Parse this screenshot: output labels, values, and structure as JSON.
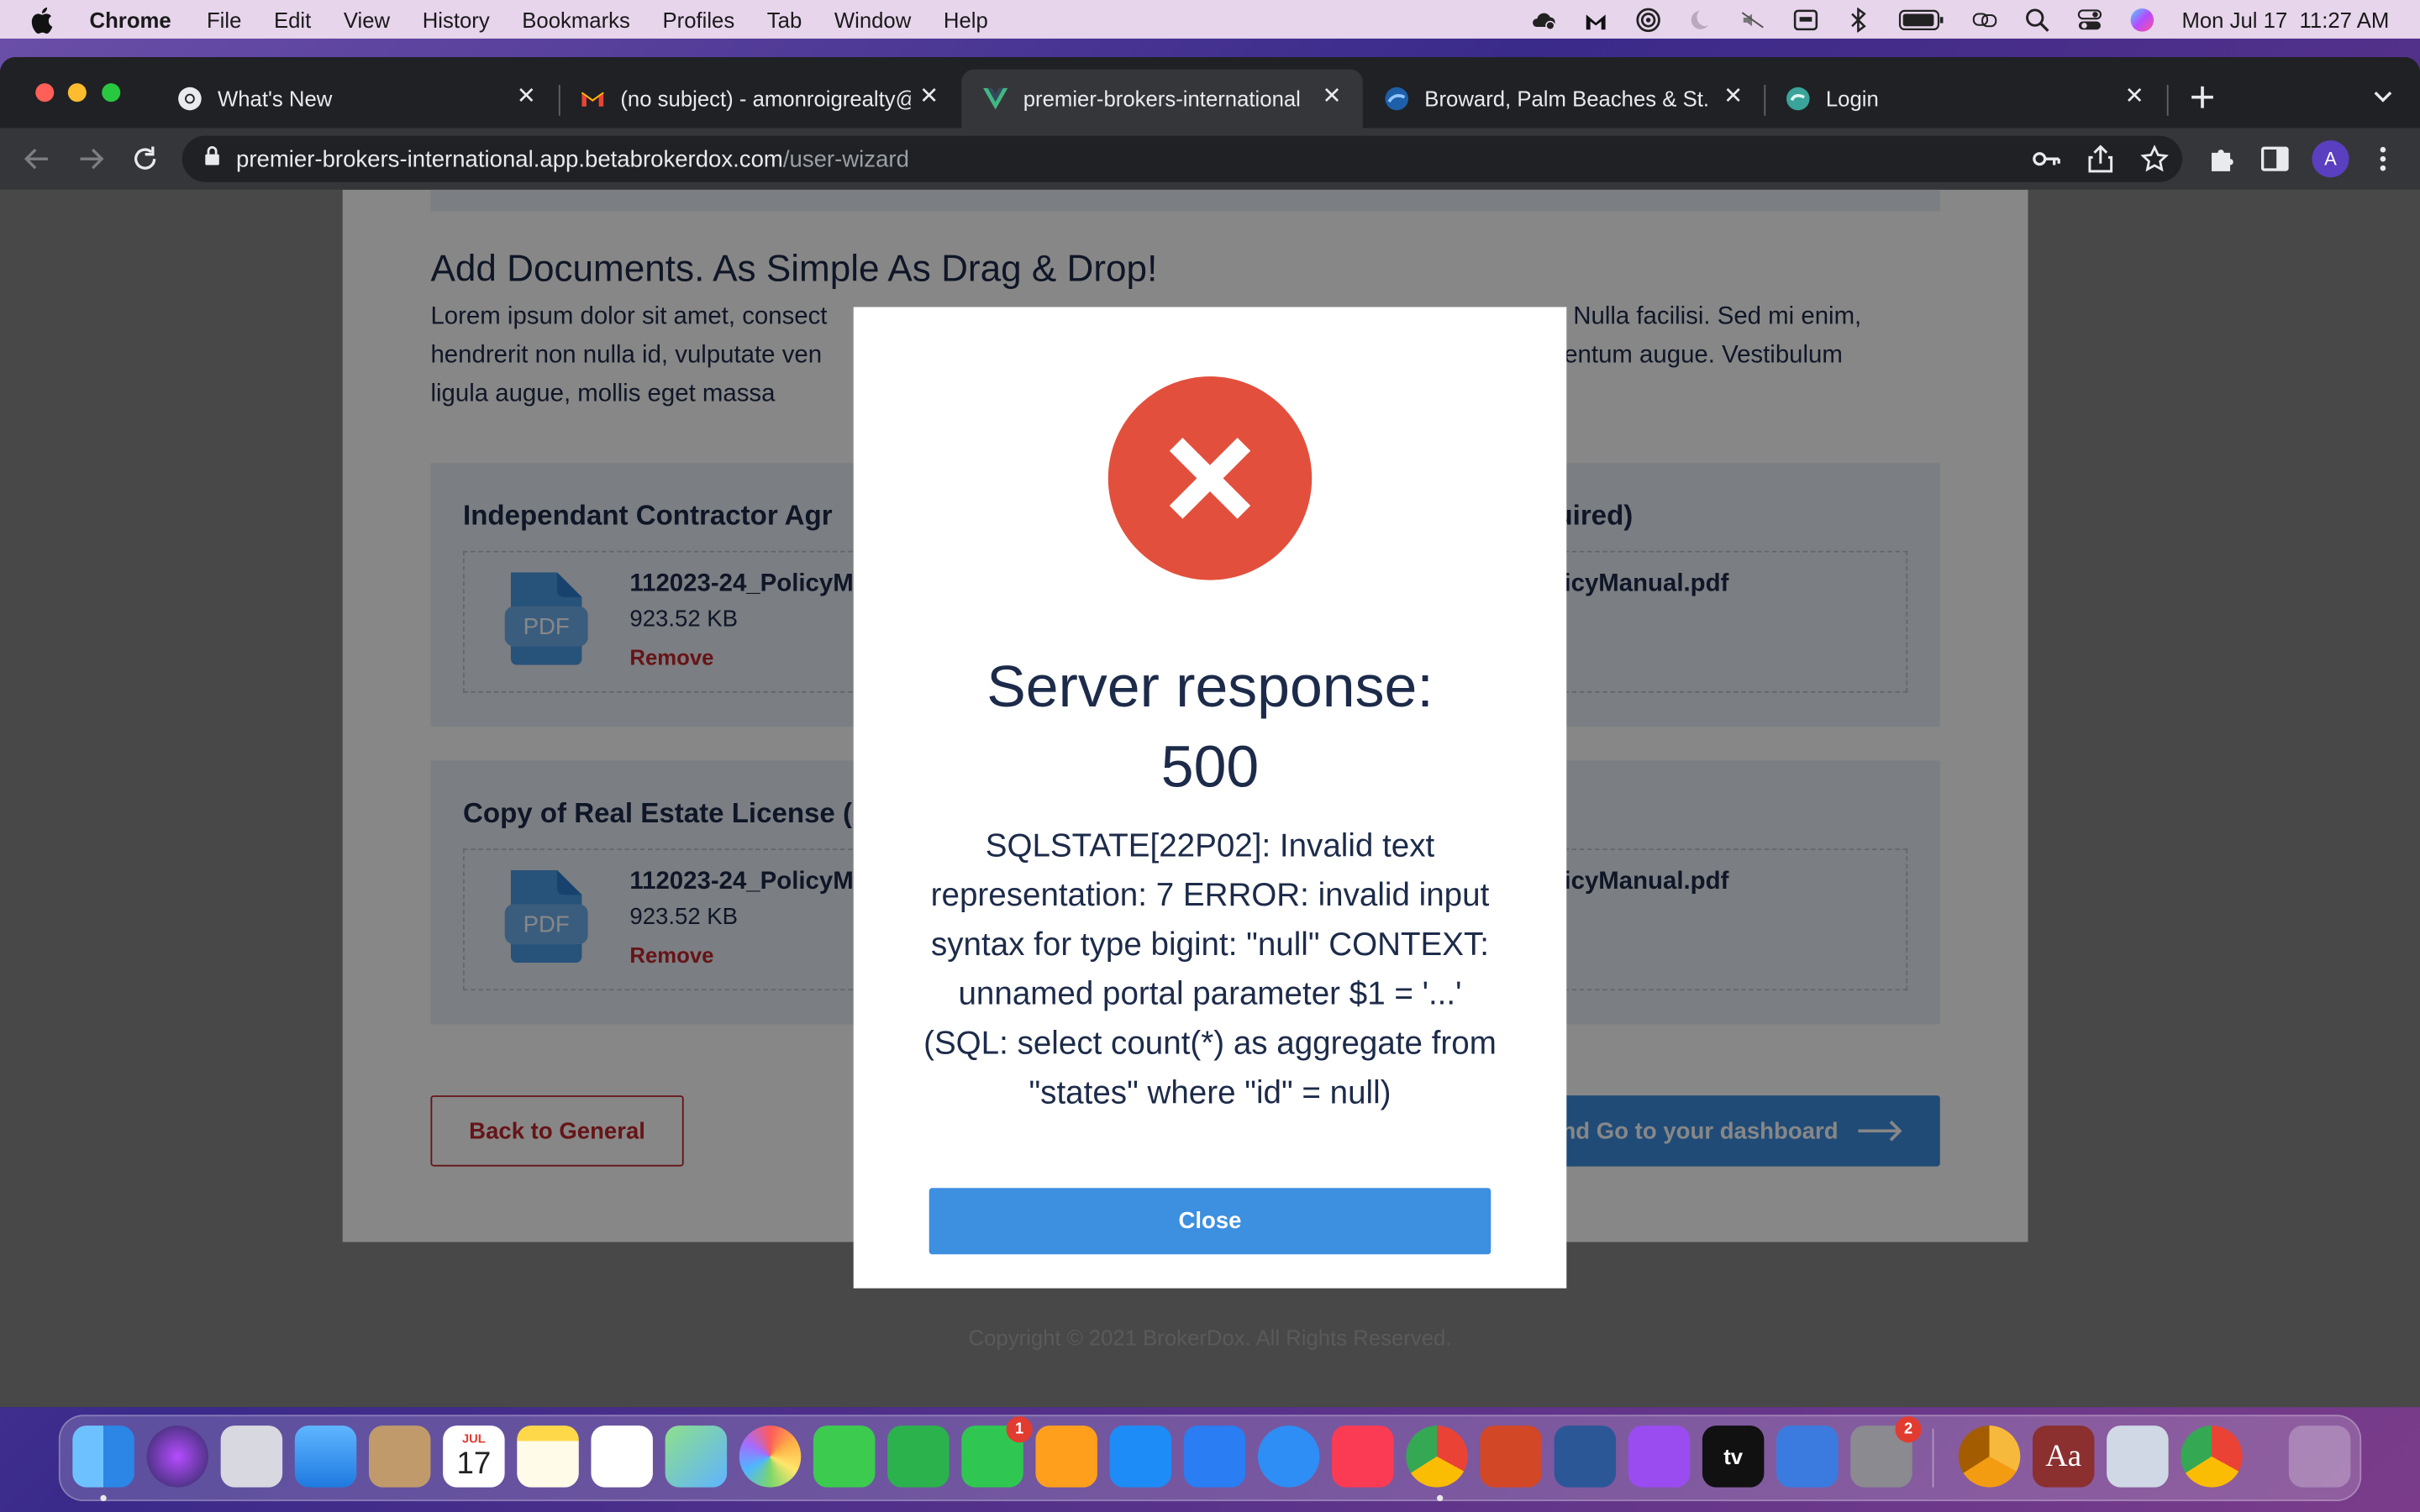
{
  "menubar": {
    "app": "Chrome",
    "items": [
      "File",
      "Edit",
      "View",
      "History",
      "Bookmarks",
      "Profiles",
      "Tab",
      "Window",
      "Help"
    ],
    "clock": "Mon Jul 17  11:27 AM"
  },
  "browser": {
    "tabs": [
      {
        "title": "What's New",
        "icon": "chrome-icon"
      },
      {
        "title": "(no subject) - amonroigrealty@",
        "icon": "gmail-icon"
      },
      {
        "title": "premier-brokers-international",
        "icon": "vue-icon"
      },
      {
        "title": "Broward, Palm Beaches & St. L",
        "icon": "realtor-icon"
      },
      {
        "title": "Login",
        "icon": "login-site-icon"
      }
    ],
    "url_host": "premier-brokers-international.app.betabrokerdox.com",
    "url_path": "/user-wizard",
    "profile_initial": "A"
  },
  "page": {
    "heading": "Add Documents. As Simple As Drag & Drop!",
    "lorem_line1_left": "Lorem ipsum dolor sit amet, consect",
    "lorem_line1_right": "r. Nulla facilisi. Sed mi enim,",
    "lorem_line2_left": "hendrerit non nulla id, vulputate ven",
    "lorem_line2_right": "mentum augue. Vestibulum",
    "lorem_line3": "ligula augue, mollis eget massa",
    "documents": [
      {
        "title": "Independant Contractor Agr",
        "title_right": "equired)",
        "file_name": "112023-24_PolicyM",
        "file_name_right": "licyManual.pdf",
        "file_size": "923.52 KB",
        "remove_label": "Remove",
        "icon_label": "PDF"
      },
      {
        "title": "Copy of Real Estate License (",
        "title_right": "",
        "file_name": "112023-24_PolicyM",
        "file_name_right": "licyManual.pdf",
        "file_size": "923.52 KB",
        "remove_label": "Remove",
        "icon_label": "PDF"
      }
    ],
    "back_label": "Back to General",
    "next_label": "nd Go to your dashboard",
    "copyright": "Copyright © 2021 BrokerDox. All Rights Reserved."
  },
  "modal": {
    "title": "Server response: 500",
    "message": "SQLSTATE[22P02]: Invalid text representation: 7 ERROR: invalid input syntax for type bigint: \"null\" CONTEXT: unnamed portal parameter $1 = '...' (SQL: select count(*) as aggregate from \"states\" where \"id\" = null)",
    "close_label": "Close"
  },
  "dock": {
    "apps": [
      {
        "name": "finder-icon"
      },
      {
        "name": "siri-icon"
      },
      {
        "name": "launchpad-icon"
      },
      {
        "name": "mail-icon"
      },
      {
        "name": "contacts-icon"
      },
      {
        "name": "calendar-icon",
        "month": "JUL",
        "day": "17"
      },
      {
        "name": "notes-icon"
      },
      {
        "name": "reminders-icon"
      },
      {
        "name": "maps-icon"
      },
      {
        "name": "photos-icon"
      },
      {
        "name": "messages-icon"
      },
      {
        "name": "numbers-icon"
      },
      {
        "name": "facetime-icon",
        "badge": "1"
      },
      {
        "name": "pages-icon"
      },
      {
        "name": "app-store-icon"
      },
      {
        "name": "keynote-icon"
      },
      {
        "name": "safari-icon"
      },
      {
        "name": "music-icon"
      },
      {
        "name": "chrome-icon"
      },
      {
        "name": "powerpoint-icon"
      },
      {
        "name": "word-icon"
      },
      {
        "name": "podcasts-icon"
      },
      {
        "name": "apple-tv-icon",
        "label": "tv"
      },
      {
        "name": "sketchup-icon"
      },
      {
        "name": "system-settings-icon",
        "badge": "2"
      },
      {
        "name": "chrome-canary-icon"
      },
      {
        "name": "dictionary-icon",
        "label": "Aa"
      },
      {
        "name": "preview-icon"
      },
      {
        "name": "chrome-profile-icon"
      },
      {
        "name": "trash-icon"
      }
    ]
  },
  "colors": {
    "accent_blue": "#3d8fe0",
    "danger_red": "#c0272d",
    "error_circle": "#e2503d",
    "text_navy": "#1d2b4a"
  }
}
